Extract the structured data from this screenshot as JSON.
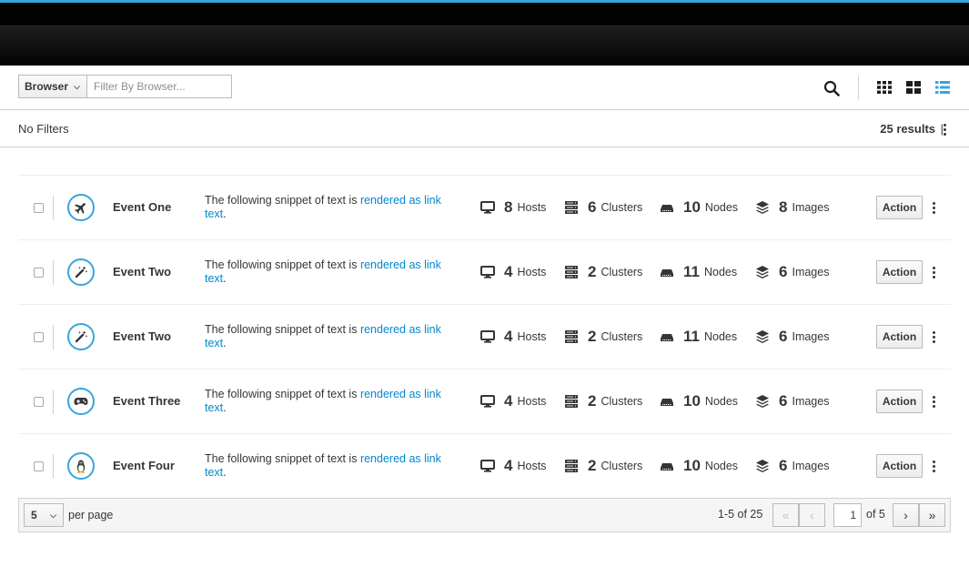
{
  "toolbar": {
    "filter_type": "Browser",
    "filter_placeholder": "Filter By Browser...",
    "icons": [
      "search-icon",
      "view-grid-small-icon",
      "view-grid-large-icon",
      "view-list-icon"
    ],
    "active_view_color": "#39a5dc"
  },
  "filters": {
    "status": "No Filters",
    "results": "25 results",
    "separator": "|"
  },
  "list": {
    "action_label": "Action",
    "desc_prefix": "The following snippet of text is ",
    "desc_link": "rendered as link text",
    "desc_suffix": ".",
    "stat_labels": {
      "hosts": "Hosts",
      "clusters": "Clusters",
      "nodes": "Nodes",
      "images": "Images"
    },
    "rows": [
      {
        "title": "Event One",
        "icon": "plane-icon",
        "hosts": "8",
        "clusters": "6",
        "nodes": "10",
        "images": "8"
      },
      {
        "title": "Event Two",
        "icon": "magic-wand-icon",
        "hosts": "4",
        "clusters": "2",
        "nodes": "11",
        "images": "6"
      },
      {
        "title": "Event Two",
        "icon": "magic-wand-icon",
        "hosts": "4",
        "clusters": "2",
        "nodes": "11",
        "images": "6"
      },
      {
        "title": "Event Three",
        "icon": "gamepad-icon",
        "hosts": "4",
        "clusters": "2",
        "nodes": "10",
        "images": "6"
      },
      {
        "title": "Event Four",
        "icon": "linux-penguin-icon",
        "hosts": "4",
        "clusters": "2",
        "nodes": "10",
        "images": "6"
      }
    ]
  },
  "pagination": {
    "per_page_value": "5",
    "per_page_label": "per page",
    "range": "1-5 of 25",
    "current_page": "1",
    "of_pages": "of 5"
  },
  "colors": {
    "accent": "#39a5dc",
    "link": "#0088ce"
  }
}
